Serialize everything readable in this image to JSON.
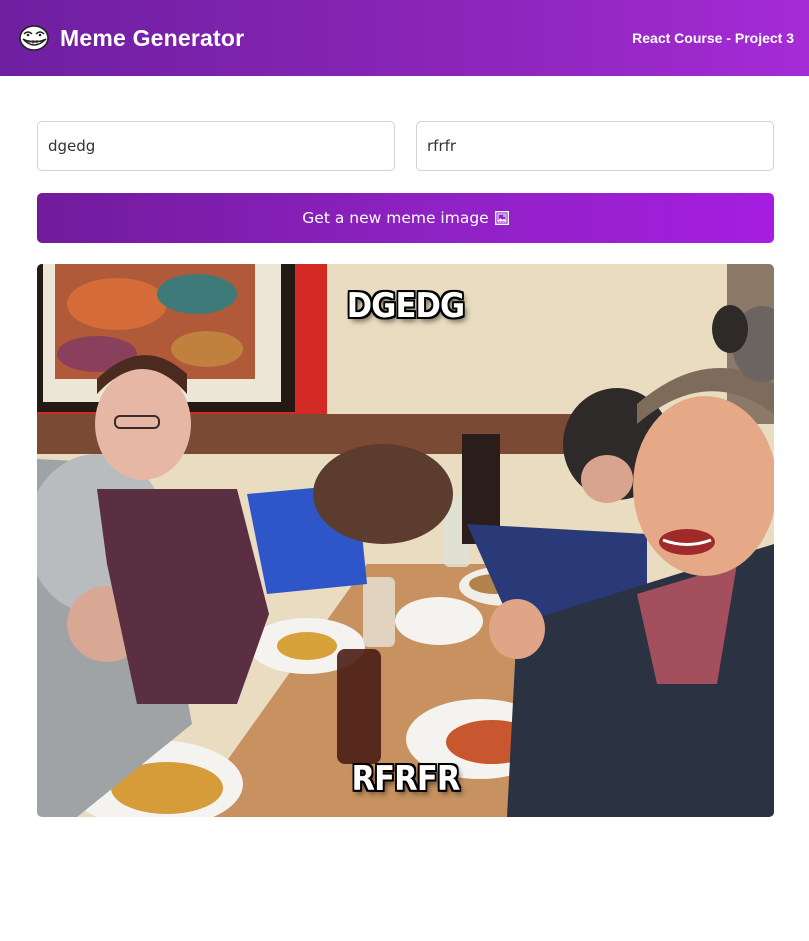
{
  "header": {
    "title": "Meme Generator",
    "course": "React Course - Project 3",
    "logo_icon": "troll-face-icon"
  },
  "form": {
    "top_text": "dgedg",
    "bottom_text": "rfrfr",
    "button_label": "Get a new meme image",
    "button_icon": "framed-picture-icon"
  },
  "meme": {
    "top_text": "DGEDG",
    "bottom_text": "RFRFR",
    "image_subject": "restaurant-table-photo"
  },
  "colors": {
    "header_gradient": [
      "#6e1fa0",
      "#a52bd6"
    ],
    "button_gradient": [
      "#711b9c",
      "#a61de0"
    ],
    "input_border": "#d2d2d2"
  }
}
